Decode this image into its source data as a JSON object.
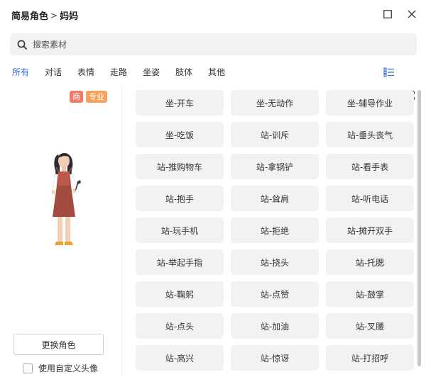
{
  "window": {
    "breadcrumb": [
      "简易角色",
      "妈妈"
    ],
    "breadcrumb_separator": ">"
  },
  "search": {
    "placeholder": "搜索素材",
    "icon": "search-icon"
  },
  "tabs": [
    {
      "label": "所有",
      "active": true
    },
    {
      "label": "对话",
      "active": false
    },
    {
      "label": "表情",
      "active": false
    },
    {
      "label": "走路",
      "active": false
    },
    {
      "label": "坐姿",
      "active": false
    },
    {
      "label": "肢体",
      "active": false
    },
    {
      "label": "其他",
      "active": false
    }
  ],
  "view_toggles": [
    "list-view-icon",
    "grid-view-icon"
  ],
  "character_panel": {
    "badges": [
      {
        "label": "商",
        "color": "#f27a6b"
      },
      {
        "label": "专业",
        "color": "#f5a25a"
      }
    ],
    "change_button": "更换角色",
    "custom_avatar_label": "使用自定义头像",
    "custom_avatar_checked": false
  },
  "actions": [
    "坐-开车",
    "坐-无动作",
    "坐-辅导作业",
    "坐-吃饭",
    "站-训斥",
    "站-垂头丧气",
    "站-推购物车",
    "站-拿锅铲",
    "站-看手表",
    "站-抱手",
    "站-耸肩",
    "站-听电话",
    "站-玩手机",
    "站-拒绝",
    "站-摊开双手",
    "站-举起手指",
    "站-挠头",
    "站-托腮",
    "站-鞠躬",
    "站-点赞",
    "站-鼓掌",
    "站-点头",
    "站-加油",
    "站-叉腰",
    "站-高兴",
    "站-惊讶",
    "站-打招呼"
  ],
  "colors": {
    "accent": "#2e6fd6",
    "tile_bg": "#f2f2f2",
    "badge_commercial": "#f27a6b",
    "badge_pro": "#f5a25a"
  }
}
